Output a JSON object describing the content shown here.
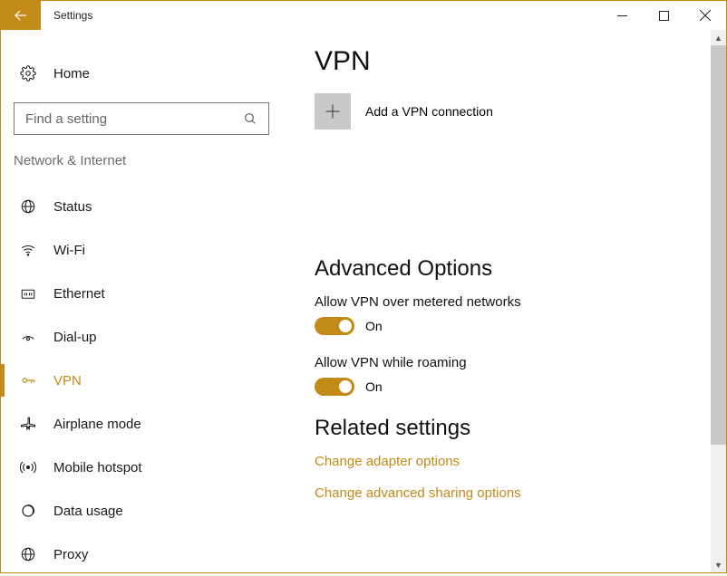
{
  "window": {
    "title": "Settings"
  },
  "sidebar": {
    "home_label": "Home",
    "search_placeholder": "Find a setting",
    "category_label": "Network & Internet",
    "items": [
      {
        "label": "Status",
        "icon": "globe-icon",
        "active": false
      },
      {
        "label": "Wi-Fi",
        "icon": "wifi-icon",
        "active": false
      },
      {
        "label": "Ethernet",
        "icon": "ethernet-icon",
        "active": false
      },
      {
        "label": "Dial-up",
        "icon": "dialup-icon",
        "active": false
      },
      {
        "label": "VPN",
        "icon": "vpn-icon",
        "active": true
      },
      {
        "label": "Airplane mode",
        "icon": "airplane-icon",
        "active": false
      },
      {
        "label": "Mobile hotspot",
        "icon": "hotspot-icon",
        "active": false
      },
      {
        "label": "Data usage",
        "icon": "datausage-icon",
        "active": false
      },
      {
        "label": "Proxy",
        "icon": "proxy-icon",
        "active": false
      }
    ]
  },
  "page": {
    "title": "VPN",
    "add_connection_label": "Add a VPN connection",
    "advanced_section_title": "Advanced Options",
    "options": [
      {
        "label": "Allow VPN over metered networks",
        "state_text": "On",
        "on": true
      },
      {
        "label": "Allow VPN while roaming",
        "state_text": "On",
        "on": true
      }
    ],
    "related_section_title": "Related settings",
    "links": [
      {
        "label": "Change adapter options"
      },
      {
        "label": "Change advanced sharing options"
      }
    ]
  }
}
